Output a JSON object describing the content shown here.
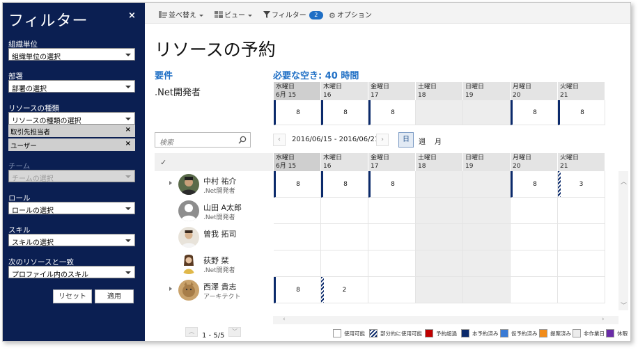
{
  "sidebar": {
    "title": "フィルター",
    "close": "×",
    "org_label": "組織単位",
    "org_value": "組織単位の選択",
    "dept_label": "部署",
    "dept_value": "部署の選択",
    "resource_type_label": "リソースの種類",
    "resource_type_value": "リソースの種類の選択",
    "resource_type_tags": [
      "取引先担当者",
      "ユーザー"
    ],
    "team_label": "チーム",
    "team_value": "チームの選択",
    "role_label": "ロール",
    "role_value": "ロールの選択",
    "skill_label": "スキル",
    "skill_value": "スキルの選択",
    "match_label": "次のリソースと一致",
    "match_value": "プロファイル内のスキル",
    "reset": "リセット",
    "apply": "適用"
  },
  "toolbar": {
    "sort": "並べ替え",
    "view": "ビュー",
    "filter": "フィルター",
    "filter_count": "2",
    "options": "オプション"
  },
  "main": {
    "title": "リソースの予約",
    "requirement_label": "要件",
    "requirement_value": ".Net開発者",
    "availability_label": "必要な空き: 40 時間"
  },
  "days": [
    {
      "dow": "水曜日",
      "date": "6月 15",
      "today": true,
      "weekend": false
    },
    {
      "dow": "木曜日",
      "date": "16",
      "today": false,
      "weekend": false
    },
    {
      "dow": "金曜日",
      "date": "17",
      "today": false,
      "weekend": false
    },
    {
      "dow": "土曜日",
      "date": "18",
      "today": false,
      "weekend": true
    },
    {
      "dow": "日曜日",
      "date": "19",
      "today": false,
      "weekend": true
    },
    {
      "dow": "月曜日",
      "date": "20",
      "today": false,
      "weekend": false
    },
    {
      "dow": "火曜日",
      "date": "21",
      "today": false,
      "weekend": false
    }
  ],
  "requirement_hours": [
    "8",
    "8",
    "8",
    "",
    "",
    "8",
    "8"
  ],
  "search": {
    "placeholder": "検索"
  },
  "date_range": "2016/06/15 - 2016/06/21",
  "view_modes": {
    "day": "日",
    "week": "週",
    "month": "月"
  },
  "resources": [
    {
      "name": "中村 祐介",
      "role": ".Net開発者",
      "expandable": true,
      "avatar": "photo-dark",
      "cells": [
        {
          "v": "8",
          "s": "booked"
        },
        {
          "v": "8",
          "s": "booked"
        },
        {
          "v": "8",
          "s": "booked"
        },
        {
          "v": "",
          "s": "weekend"
        },
        {
          "v": "",
          "s": "weekend"
        },
        {
          "v": "8",
          "s": "booked"
        },
        {
          "v": "3",
          "s": "partial"
        }
      ]
    },
    {
      "name": "山田 A太郎",
      "role": ".Net開発者",
      "expandable": false,
      "avatar": "placeholder",
      "cells": [
        {
          "v": "",
          "s": ""
        },
        {
          "v": "",
          "s": ""
        },
        {
          "v": "",
          "s": ""
        },
        {
          "v": "",
          "s": "weekend"
        },
        {
          "v": "",
          "s": "weekend"
        },
        {
          "v": "",
          "s": ""
        },
        {
          "v": "",
          "s": ""
        }
      ]
    },
    {
      "name": "曽我 拓司",
      "role": "",
      "expandable": false,
      "avatar": "photo-light",
      "cells": [
        {
          "v": "",
          "s": ""
        },
        {
          "v": "",
          "s": ""
        },
        {
          "v": "",
          "s": ""
        },
        {
          "v": "",
          "s": "weekend"
        },
        {
          "v": "",
          "s": "weekend"
        },
        {
          "v": "",
          "s": ""
        },
        {
          "v": "",
          "s": ""
        }
      ]
    },
    {
      "name": "荻野 栞",
      "role": ".Net開発者",
      "expandable": false,
      "avatar": "photo-woman",
      "cells": [
        {
          "v": "",
          "s": ""
        },
        {
          "v": "",
          "s": ""
        },
        {
          "v": "",
          "s": ""
        },
        {
          "v": "",
          "s": "weekend"
        },
        {
          "v": "",
          "s": "weekend"
        },
        {
          "v": "",
          "s": ""
        },
        {
          "v": "",
          "s": ""
        }
      ]
    },
    {
      "name": "西澤 貴志",
      "role": "アーキテクト",
      "expandable": true,
      "avatar": "photo-cat",
      "cells": [
        {
          "v": "8",
          "s": "booked"
        },
        {
          "v": "2",
          "s": "partial"
        },
        {
          "v": "",
          "s": ""
        },
        {
          "v": "",
          "s": "weekend"
        },
        {
          "v": "",
          "s": "weekend"
        },
        {
          "v": "",
          "s": ""
        },
        {
          "v": "",
          "s": ""
        }
      ]
    }
  ],
  "pager": "1 - 5/5",
  "legend": [
    {
      "label": "使用可能",
      "color": "#ffffff",
      "pattern": "none"
    },
    {
      "label": "部分的に使用可能",
      "color": "#0b2a6b",
      "pattern": "stripe"
    },
    {
      "label": "予約超過",
      "color": "#c00000",
      "pattern": "none"
    },
    {
      "label": "本予約済み",
      "color": "#0b2a6b",
      "pattern": "none"
    },
    {
      "label": "仮予約済み",
      "color": "#3a7bd5",
      "pattern": "none"
    },
    {
      "label": "提案済み",
      "color": "#f28c1a",
      "pattern": "none"
    },
    {
      "label": "非作業日",
      "color": "#ececec",
      "pattern": "none"
    },
    {
      "label": "休暇",
      "color": "#6a2ca8",
      "pattern": "none"
    }
  ],
  "colors": {
    "sidebar": "#0b1f52",
    "accent": "#1f6fc5",
    "booked": "#0b2a6b"
  }
}
